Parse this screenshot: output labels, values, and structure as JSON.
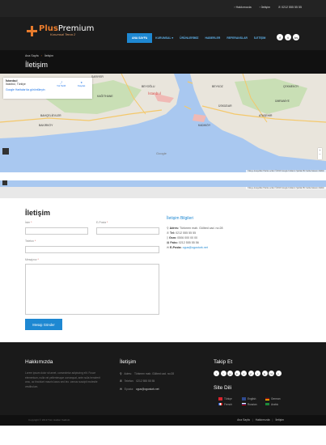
{
  "header": {
    "top_links": [
      "Hakkımızda",
      "İletişim",
      "0212 555 55 55"
    ],
    "logo": {
      "main_a": "Plus",
      "main_b": "Premium",
      "sub": "Kurumsal Tema 2"
    },
    "nav": [
      "ANA SAYFA",
      "KURUMSAL ▾",
      "ÜRÜNLERİMİZ",
      "HABERLER",
      "REFERANSLAR",
      "İLETİŞİM"
    ],
    "socials": [
      "f",
      "t",
      "in"
    ]
  },
  "title_bar": {
    "breadcrumb": [
      "Ana Sayfa",
      "İletişim"
    ],
    "title": "İletişim"
  },
  "map": {
    "card_title": "İstanbul",
    "card_sub": "İstanbul, Türkiye",
    "card_link": "Google Haritalar'da görüntüleyin",
    "directions": "Yol Tarifi",
    "save": "Kaydet",
    "labels": [
      "SARIYER",
      "BEYKOZ",
      "KAĞITHANE",
      "ÜSKÜDAR",
      "BAHÇELİEVLER",
      "BAKIRKÖY",
      "KADIKÖY",
      "ATAŞEHİR",
      "BEYOĞLU",
      "ÇEKMEKÖY",
      "ÜMRANİYE"
    ],
    "city": "İstanbul",
    "google": "Google",
    "footer_text": "Klavye kısayolları   Harita verileri ©2019 Google   Kullanım Şartları   Bir harita hatasını bildirin"
  },
  "contact": {
    "title": "İletişim",
    "name_label": "İsim",
    "email_label": "E-Posta",
    "phone_label": "Telefon",
    "message_label": "Mesajınız",
    "required": "*",
    "submit": "Mesajı Gönder",
    "info_title": "İletişim Bilgileri",
    "address_label": "Adres:",
    "address": "Türkmen mah. Gülbed cad. no:28",
    "phone1_label": "Tel:",
    "phone1": "0212 555 55 55",
    "gsm_label": "Gsm:",
    "gsm": "0506 000 00 00",
    "fax_label": "Faks:",
    "fax": "0212 555 55 56",
    "mail_label": "E-Posta:",
    "mail": "ogus@ogusturk.net"
  },
  "footer": {
    "about_title": "Hakkımızda",
    "about_text": "Lorem ipsum dolor sit amet, consectetur adipiscing elit. Fusce elementum, nulla vel pellentesque consequat, ante nulla hendrerit arcu, ac tincidunt mauris lacus sed leo. vamus suscipit molestie vestibulum.",
    "contact_title": "İletişim",
    "contact_items": [
      {
        "label": "Adres:",
        "value": "Türkmen mah. Gülbed cad. no:28"
      },
      {
        "label": "Telefon:",
        "value": "0212 555 55 55"
      },
      {
        "label": "Eposta:",
        "value": "ogus@ogusturk.net"
      }
    ],
    "follow_title": "Takip Et",
    "follow_icons": [
      "f",
      "t",
      "g+",
      "in",
      "p",
      "yt",
      "v",
      "ig",
      "rss",
      "s"
    ],
    "lang_title": "Site Dili",
    "languages": [
      {
        "name": "Türkçe",
        "color": "#d9232e"
      },
      {
        "name": "English",
        "color": "#2f4a8f"
      },
      {
        "name": "German",
        "color": "#f2c200"
      },
      {
        "name": "French",
        "color": "#2b57c2"
      },
      {
        "name": "Russian",
        "color": "#d0d0e0"
      },
      {
        "name": "Arabic",
        "color": "#1e8a3a"
      }
    ],
    "copyright": "Copyright © 2019 Tüm Hakları Saklıdır.",
    "links": [
      "Ana Sayfa",
      "Hakkımızda",
      "İletişim"
    ]
  },
  "colors": {
    "accent": "#1e88d2",
    "brand": "#e87b2c"
  }
}
